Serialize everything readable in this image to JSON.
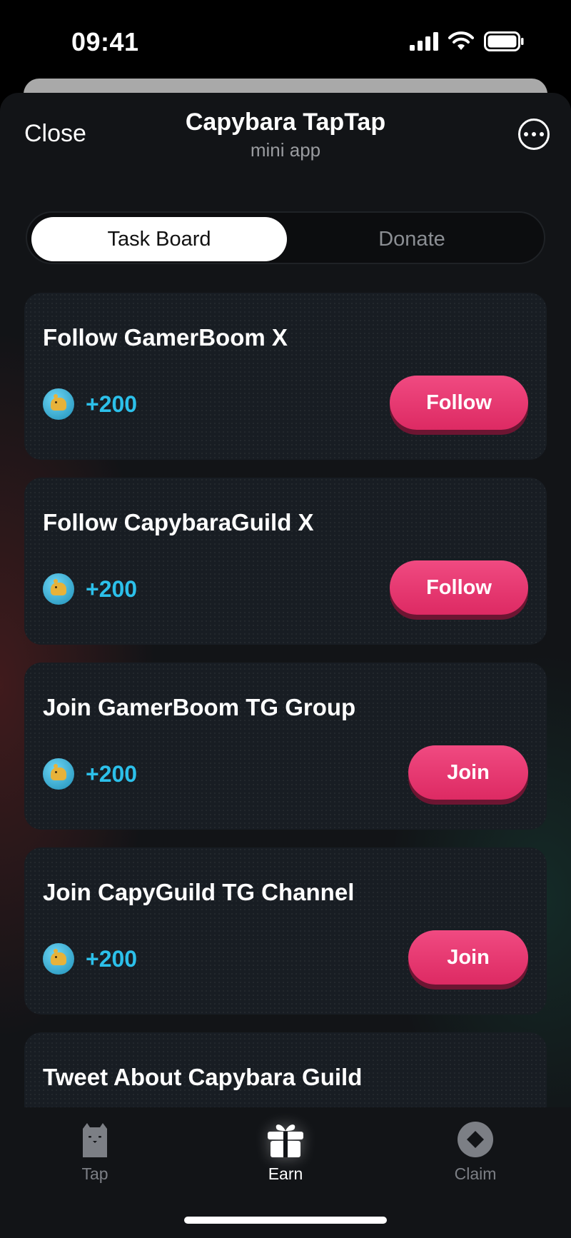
{
  "status_bar": {
    "time": "09:41"
  },
  "header": {
    "close_label": "Close",
    "title": "Capybara TapTap",
    "subtitle": "mini app"
  },
  "tabs": [
    {
      "label": "Task Board",
      "active": true
    },
    {
      "label": "Donate",
      "active": false
    }
  ],
  "tasks": [
    {
      "title": "Follow GamerBoom X",
      "reward": "+200",
      "action": "Follow"
    },
    {
      "title": "Follow CapybaraGuild X",
      "reward": "+200",
      "action": "Follow"
    },
    {
      "title": "Join GamerBoom TG Group",
      "reward": "+200",
      "action": "Join"
    },
    {
      "title": "Join CapyGuild TG Channel",
      "reward": "+200",
      "action": "Join"
    },
    {
      "title": "Tweet About Capybara Guild"
    }
  ],
  "nav": [
    {
      "label": "Tap",
      "icon": "capybara-icon"
    },
    {
      "label": "Earn",
      "icon": "gift-icon",
      "active": true
    },
    {
      "label": "Claim",
      "icon": "diamond-coin-icon"
    }
  ],
  "colors": {
    "accent": "#e8336e",
    "reward": "#2cc0ea",
    "background": "#121417"
  }
}
